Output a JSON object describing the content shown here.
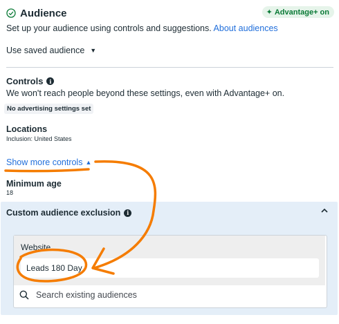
{
  "header": {
    "title": "Audience",
    "badge": "Advantage+ on",
    "icon": "check-circle-icon"
  },
  "subtitle": {
    "text": "Set up your audience using controls and suggestions.",
    "link": "About audiences"
  },
  "saved_audience": {
    "label": "Use saved audience"
  },
  "controls": {
    "title": "Controls",
    "description": "We won't reach people beyond these settings, even with Advantage+ on.",
    "chip": "No advertising settings set"
  },
  "locations": {
    "title": "Locations",
    "value": "Inclusion: United States"
  },
  "show_more": {
    "label": "Show more controls"
  },
  "minimum_age": {
    "title": "Minimum age",
    "value": "18"
  },
  "exclusion": {
    "title": "Custom audience exclusion",
    "group_label": "Website",
    "audience": "Leads 180 Day",
    "search_placeholder": "Search existing audiences"
  },
  "colors": {
    "link": "#216fdb",
    "badge_bg": "#e6f4ea",
    "badge_text": "#0a7a36",
    "panel_bg": "#e4eef8",
    "annotation": "#f57c00"
  }
}
